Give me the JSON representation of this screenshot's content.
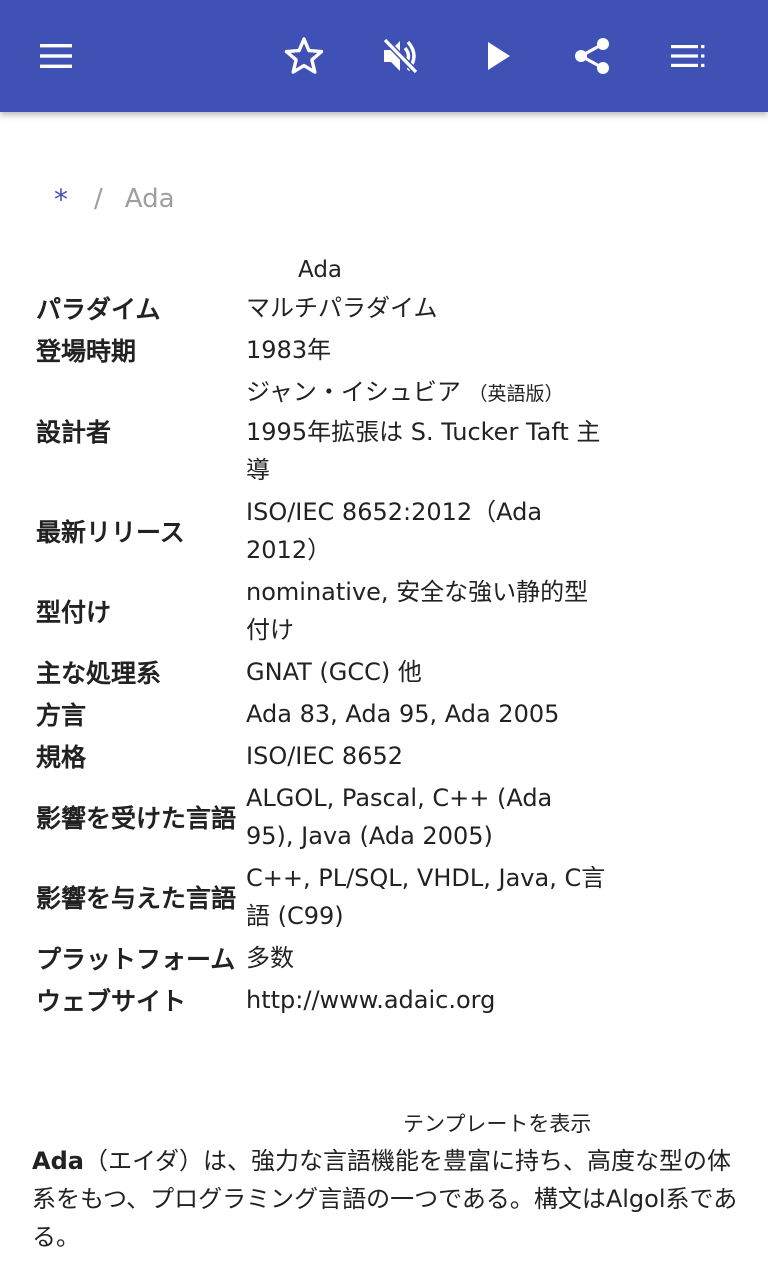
{
  "toolbar": {
    "menu_icon": "menu-icon",
    "favorite_icon": "star-outline-icon",
    "sound_icon": "volume-off-icon",
    "play_icon": "play-icon",
    "share_icon": "share-icon",
    "toc_icon": "toc-icon",
    "color": "#3f51b5"
  },
  "breadcrumb": {
    "home": "*",
    "separator": "/",
    "current": "Ada"
  },
  "infobox": {
    "caption": "Ada",
    "rows": [
      {
        "label": "パラダイム",
        "value": "マルチパラダイム"
      },
      {
        "label": "登場時期",
        "value": "1983年"
      },
      {
        "label": "設計者",
        "value_line1": "ジャン・イシュビア",
        "value_note": "（英語版）",
        "value_line2": "1995年拡張は S. Tucker Taft 主導"
      },
      {
        "label": "最新リリース",
        "value": "ISO/IEC 8652:2012（Ada 2012）"
      },
      {
        "label": "型付け",
        "value": "nominative, 安全な強い静的型付け"
      },
      {
        "label": "主な処理系",
        "value": "GNAT (GCC) 他"
      },
      {
        "label": "方言",
        "value": "Ada 83, Ada 95, Ada 2005"
      },
      {
        "label": "規格",
        "value": "ISO/IEC 8652"
      },
      {
        "label": "影響を受けた言語",
        "value": "ALGOL, Pascal, C++ (Ada 95), Java (Ada 2005)"
      },
      {
        "label": "影響を与えた言語",
        "value": "C++, PL/SQL, VHDL, Java, C言語 (C99)"
      },
      {
        "label": "プラットフォーム",
        "value": "多数"
      },
      {
        "label": "ウェブサイト",
        "value": "http://www.adaic.org"
      }
    ],
    "template_link": "テンプレートを表示"
  },
  "intro": {
    "term": "Ada",
    "text": "（エイダ）は、強力な言語機能を豊富に持ち、高度な型の体系をもつ、プログラミング言語の一つである。構文はAlgol系である。"
  }
}
